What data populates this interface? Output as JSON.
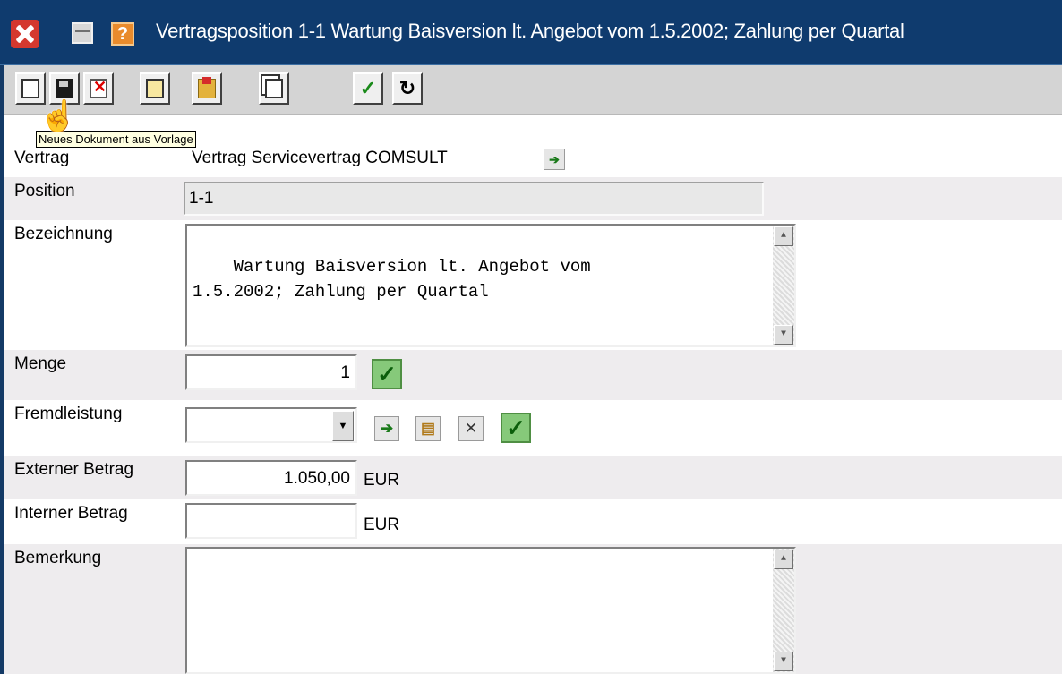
{
  "window": {
    "title": "Vertragsposition 1-1 Wartung Baisversion lt. Angebot vom 1.5.2002; Zahlung per Quartal"
  },
  "toolbar": {
    "tooltip": "Neues Dokument aus Vorlage",
    "buttons": [
      "new-document",
      "save",
      "delete",
      "structure",
      "open-folder",
      "copy",
      "confirm",
      "refresh"
    ]
  },
  "form": {
    "vertrag": {
      "label": "Vertrag",
      "value": "Vertrag Servicevertrag COMSULT"
    },
    "position": {
      "label": "Position",
      "value": "1-1"
    },
    "bezeichnung": {
      "label": "Bezeichnung",
      "value": "Wartung Baisversion lt. Angebot vom\n1.5.2002; Zahlung per Quartal"
    },
    "menge": {
      "label": "Menge",
      "value": "1"
    },
    "fremdleistung": {
      "label": "Fremdleistung",
      "value": ""
    },
    "externer_betrag": {
      "label": "Externer Betrag",
      "value": "1.050,00",
      "unit": "EUR"
    },
    "interner_betrag": {
      "label": "Interner Betrag",
      "value": "",
      "unit": "EUR"
    },
    "bemerkung": {
      "label": "Bemerkung",
      "value": ""
    }
  },
  "colors": {
    "titlebar": "#0f3b6e",
    "toolbar": "#d4d4d4",
    "row_shade": "#eeecee",
    "ok_green": "#86c97a"
  }
}
